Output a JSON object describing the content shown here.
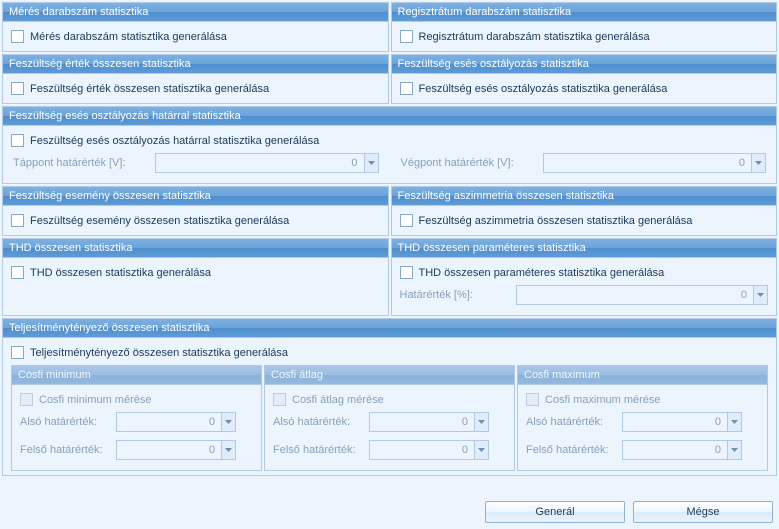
{
  "panels": {
    "meresDarab": {
      "title": "Mérés darabszám statisztika",
      "chk": "Mérés darabszám statisztika generálása"
    },
    "regDarab": {
      "title": "Regisztrátum darabszám statisztika",
      "chk": "Regisztrátum darabszám statisztika generálása"
    },
    "feszErtek": {
      "title": "Feszültség érték összesen statisztika",
      "chk": "Feszültség érték összesen statisztika generálása"
    },
    "feszEsesOszt": {
      "title": "Feszültség esés osztályozás statisztika",
      "chk": "Feszültség esés osztályozás statisztika generálása"
    },
    "feszEsesHatar": {
      "title": "Feszültség esés osztályozás határral statisztika",
      "chk": "Feszültség esés osztályozás határral statisztika generálása",
      "tappontLabel": "Táppont határérték [V]:",
      "vegpontLabel": "Végpont határérték [V]:",
      "tappontVal": "0",
      "vegpontVal": "0"
    },
    "feszEsemeny": {
      "title": "Feszültség esemény összesen statisztika",
      "chk": "Feszültség esemény összesen statisztika generálása"
    },
    "feszAszimm": {
      "title": "Feszültség aszimmetria összesen statisztika",
      "chk": "Feszültség aszimmetria összesen statisztika generálása"
    },
    "thdOssz": {
      "title": "THD összesen statisztika",
      "chk": "THD összesen statisztika generálása"
    },
    "thdParam": {
      "title": "THD összesen paraméteres statisztika",
      "chk": "THD összesen paraméteres statisztika generálása",
      "hatarLabel": "Határérték [%]:",
      "hatarVal": "0"
    },
    "telj": {
      "title": "Teljesítménytényező összesen statisztika",
      "chk": "Teljesítménytényező összesen statisztika generálása"
    },
    "cosfiMin": {
      "title": "Cosfi minimum",
      "chk": "Cosfi minimum mérése",
      "also": "Alsó határérték:",
      "felso": "Felső határérték:",
      "alsoVal": "0",
      "felsoVal": "0"
    },
    "cosfiAtlag": {
      "title": "Cosfi átlag",
      "chk": "Cosfi átlag mérése",
      "also": "Alsó határérték:",
      "felso": "Felső határérték:",
      "alsoVal": "0",
      "felsoVal": "0"
    },
    "cosfiMax": {
      "title": "Cosfi maximum",
      "chk": "Cosfi maximum mérése",
      "also": "Alsó határérték:",
      "felso": "Felső határérték:",
      "alsoVal": "0",
      "felsoVal": "0"
    }
  },
  "buttons": {
    "general": "Generál",
    "megse": "Mégse"
  }
}
